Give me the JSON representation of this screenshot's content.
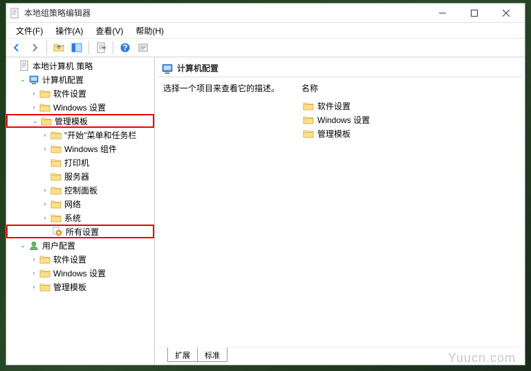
{
  "window": {
    "title": "本地组策略编辑器"
  },
  "menubar": {
    "file": "文件(F)",
    "action": "操作(A)",
    "view": "查看(V)",
    "help": "帮助(H)"
  },
  "tree": {
    "root": "本地计算机 策略",
    "computer": "计算机配置",
    "software_settings": "软件设置",
    "windows_settings": "Windows 设置",
    "admin_templates": "管理模板",
    "start_menu": "\"开始\"菜单和任务栏",
    "windows_components": "Windows 组件",
    "printer": "打印机",
    "server": "服务器",
    "control_panel": "控制面板",
    "network": "网络",
    "system": "系统",
    "all_settings": "所有设置",
    "user": "用户配置",
    "u_software": "软件设置",
    "u_windows": "Windows 设置",
    "u_admin": "管理模板"
  },
  "content": {
    "header": "计算机配置",
    "description": "选择一个项目来查看它的描述。",
    "name_header": "名称",
    "items": [
      "软件设置",
      "Windows 设置",
      "管理模板"
    ]
  },
  "tabs": {
    "extended": "扩展",
    "standard": "标准"
  },
  "watermark": "Yuucn.com"
}
